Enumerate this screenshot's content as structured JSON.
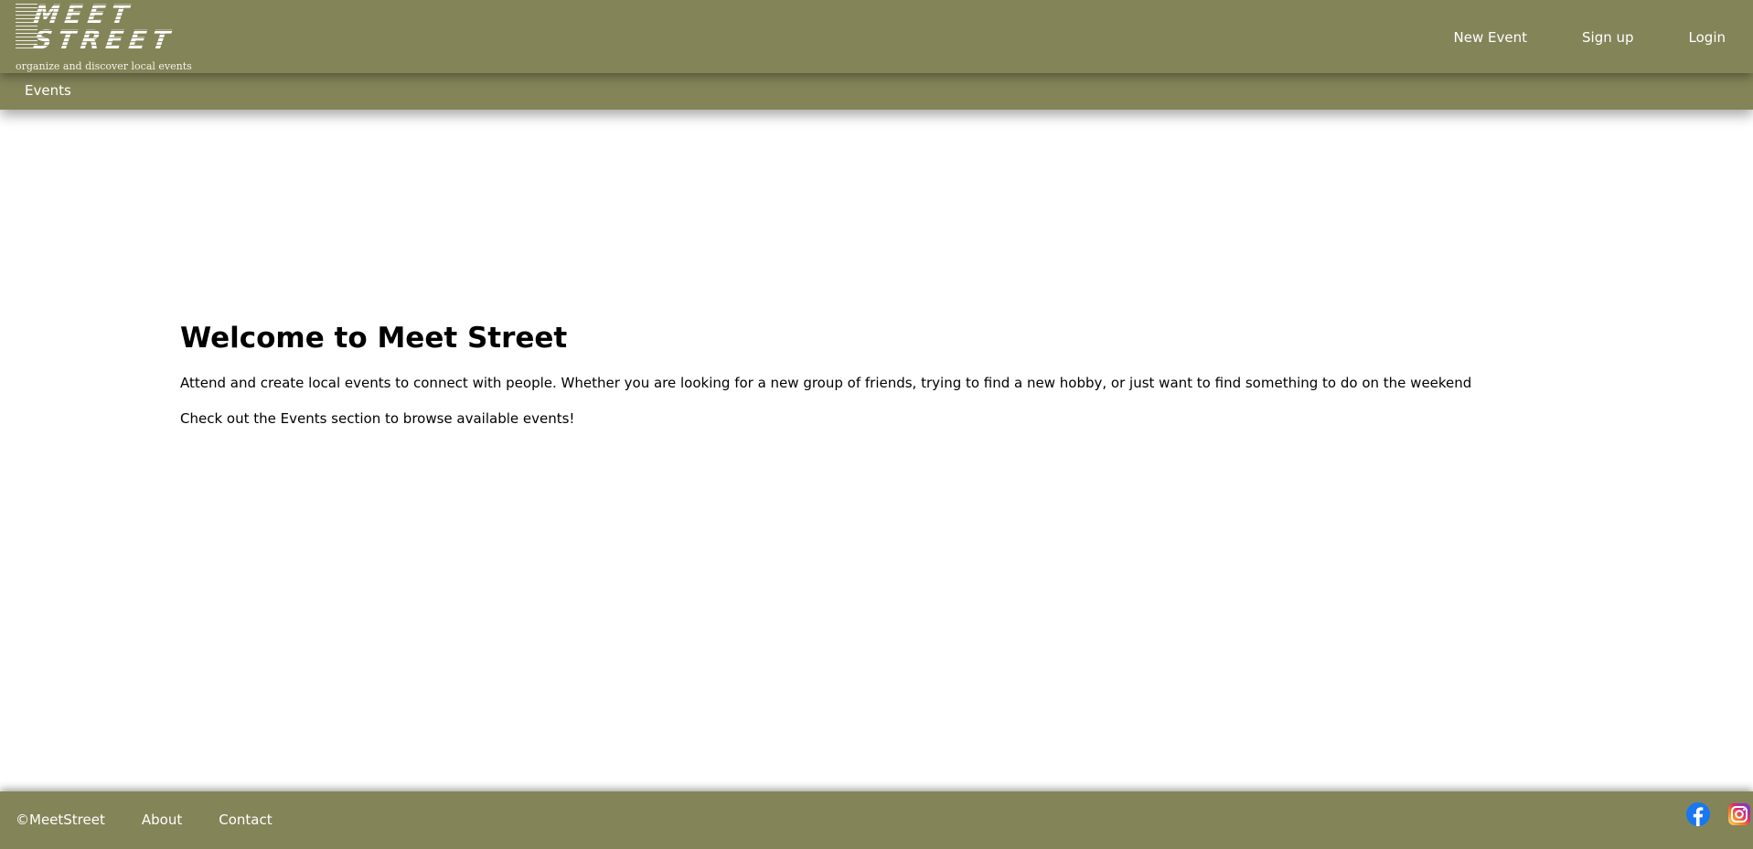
{
  "header": {
    "logo": {
      "line1": "MEET",
      "line2": "STREET",
      "tagline": "organize and discover local events"
    },
    "nav": {
      "new_event": "New Event",
      "sign_up": "Sign up",
      "login": "Login"
    }
  },
  "subnav": {
    "events": "Events"
  },
  "main": {
    "title": "Welcome to Meet Street",
    "intro": "Attend and create local events to connect with people. Whether you are looking for a new group of friends, trying to find a new hobby, or just want to find something to do on the weekend",
    "browse": "Check out the Events section to browse available events!"
  },
  "footer": {
    "copyright": "©MeetStreet",
    "about": "About",
    "contact": "Contact",
    "social": [
      {
        "name": "facebook-icon",
        "color": "#1877f2"
      },
      {
        "name": "instagram-icon",
        "color": "#e1306c"
      }
    ]
  },
  "colors": {
    "brand": "#848459",
    "text_light": "#ffffff",
    "body_text": "#000000"
  }
}
